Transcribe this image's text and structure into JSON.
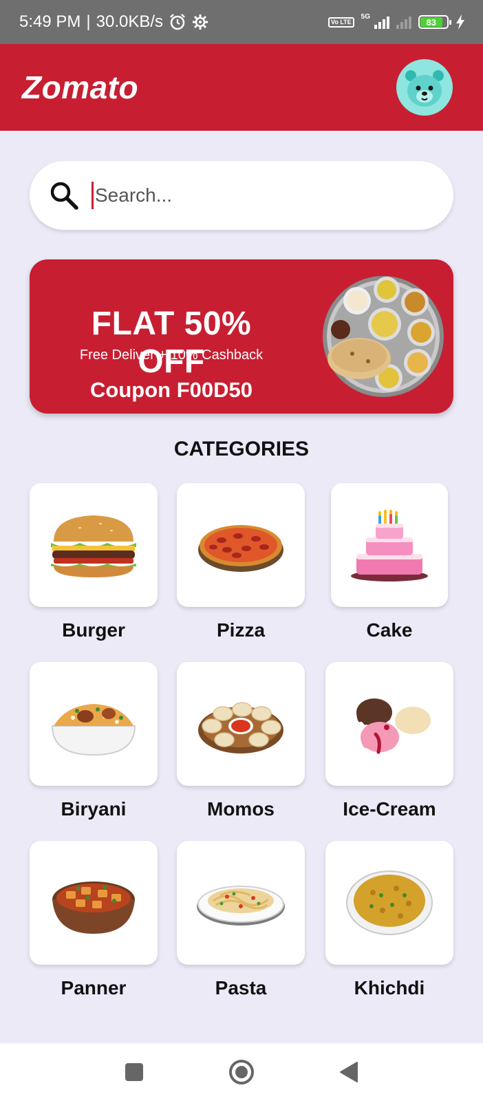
{
  "status_bar": {
    "time": "5:49 PM",
    "separator": "|",
    "speed": "30.0KB/s",
    "network_type": "5G",
    "volte": "Vo LTE",
    "battery_level": "83"
  },
  "app_bar": {
    "title": "Zomato",
    "avatar_icon": "bear-avatar-icon"
  },
  "search": {
    "placeholder": "Search...",
    "value": ""
  },
  "promo": {
    "headline": "FLAT 50% OFF",
    "subtext": "Free Deliver + 10% Cashback",
    "coupon": "Coupon F00D50",
    "background": "#c81e32"
  },
  "categories": {
    "title": "CATEGORIES",
    "items": [
      {
        "label": "Burger",
        "icon": "burger-icon"
      },
      {
        "label": "Pizza",
        "icon": "pizza-icon"
      },
      {
        "label": "Cake",
        "icon": "cake-icon"
      },
      {
        "label": "Biryani",
        "icon": "biryani-icon"
      },
      {
        "label": "Momos",
        "icon": "momos-icon"
      },
      {
        "label": "Ice-Cream",
        "icon": "ice-cream-icon"
      },
      {
        "label": "Panner",
        "icon": "paneer-icon"
      },
      {
        "label": "Pasta",
        "icon": "pasta-icon"
      },
      {
        "label": "Khichdi",
        "icon": "khichdi-icon"
      }
    ]
  },
  "colors": {
    "brand": "#c81e32",
    "background": "#ebeaf6",
    "status_bar": "#6f6f6f"
  }
}
